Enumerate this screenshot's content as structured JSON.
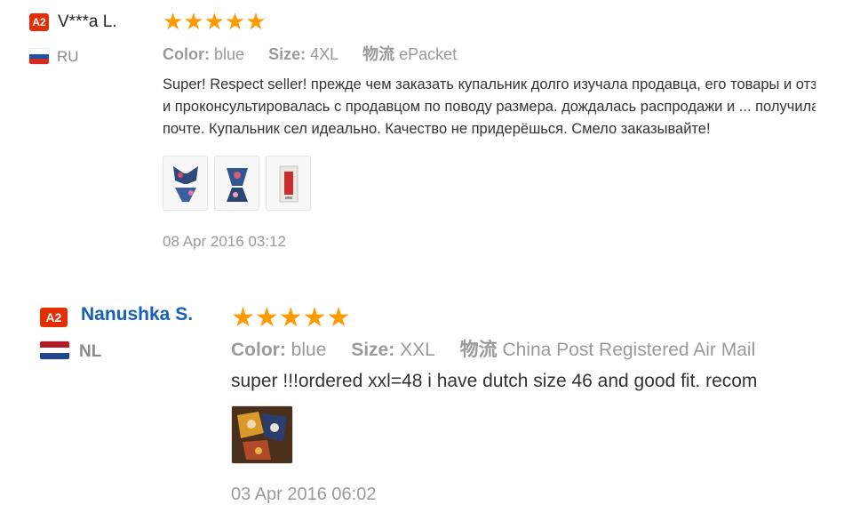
{
  "reviews": [
    {
      "badge": "A2",
      "user": "V***a L.",
      "flag_colors": [
        "#ffffff",
        "#1c57a5",
        "#d52b1e"
      ],
      "country": "RU",
      "stars": "★★★★★",
      "rating": 5,
      "color_label": "Color:",
      "color_value": "blue",
      "size_label": "Size:",
      "size_value": "4XL",
      "shipping_label": "物流",
      "shipping_value": "ePacket",
      "text_lines": [
        "Super! Respect seller! прежде чем заказать купальник долго изучала продавца, его товары и отзы",
        "и проконсультировалась с продавцом по поводу размера. дождалась распродажи и ... получила",
        "почте. Купальник сел идеально. Качество не придерёшься. Смело заказывайте!"
      ],
      "photos": [
        "photo-icon",
        "photo-icon",
        "photo-icon"
      ],
      "date": "08 Apr 2016 03:12"
    },
    {
      "badge": "A2",
      "user": "Nanushka S.",
      "flag_colors": [
        "#ae1c28",
        "#ffffff",
        "#21468b"
      ],
      "country": "NL",
      "stars": "★★★★★",
      "rating": 5,
      "color_label": "Color:",
      "color_value": "blue",
      "size_label": "Size:",
      "size_value": "XXL",
      "shipping_label": "物流",
      "shipping_value": "China Post Registered Air Mail",
      "text_lines": [
        "super !!!ordered xxl=48 i have dutch size 46 and good fit. recom"
      ],
      "photos": [
        "photo-icon"
      ],
      "date": "03 Apr 2016 06:02"
    }
  ],
  "colors": {
    "badge": "#e62e04",
    "star": "#ff9a00",
    "user_link": "#1660b8"
  }
}
